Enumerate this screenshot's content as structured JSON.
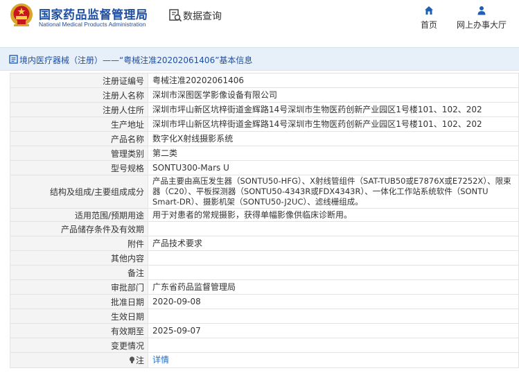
{
  "header": {
    "org_cn": "国家药品监督管理局",
    "org_en": "National Medical Products Administration",
    "query_label": "数据查询",
    "nav": [
      {
        "label": "首页",
        "icon": "home-icon"
      },
      {
        "label": "网上办事大厅",
        "icon": "user-icon"
      }
    ]
  },
  "title_bar": {
    "text": "境内医疗器械（注册）——“粤械注准20202061406”基本信息",
    "icon": "document-icon"
  },
  "detail": {
    "rows": [
      {
        "label": "注册证编号",
        "value": "粤械注准20202061406"
      },
      {
        "label": "注册人名称",
        "value": "深圳市深图医学影像设备有限公司"
      },
      {
        "label": "注册人住所",
        "value": "深圳市坪山新区坑梓街道金辉路14号深圳市生物医药创新产业园区1号楼101、102、202"
      },
      {
        "label": "生产地址",
        "value": "深圳市坪山新区坑梓街道金辉路14号深圳市生物医药创新产业园区1号楼101、102、202"
      },
      {
        "label": "产品名称",
        "value": "数字化X射线摄影系统"
      },
      {
        "label": "管理类别",
        "value": "第二类"
      },
      {
        "label": "型号规格",
        "value": "SONTU300-Mars U"
      },
      {
        "label": "结构及组成/主要组成成分",
        "value": "产品主要由高压发生器（SONTU50-HFG）、X射线管组件（SAT-TUB50或E7876X或E7252X）、限束器（C20）、平板探测器（SONTU50-4343R或FDX4343R）、一体化工作站系统软件（SONTU Smart-DR）、摄影机架（SONTU50-J2UC）、滤线栅组成。"
      },
      {
        "label": "适用范围/预期用途",
        "value": "用于对患者的常规摄影，获得单幅影像供临床诊断用。"
      },
      {
        "label": "产品储存条件及有效期",
        "value": ""
      },
      {
        "label": "附件",
        "value": "产品技术要求"
      },
      {
        "label": "其他内容",
        "value": ""
      },
      {
        "label": "备注",
        "value": ""
      },
      {
        "label": "审批部门",
        "value": "广东省药品监督管理局"
      },
      {
        "label": "批准日期",
        "value": "2020-09-08"
      },
      {
        "label": "生效日期",
        "value": ""
      },
      {
        "label": "有效期至",
        "value": "2025-09-07"
      },
      {
        "label": "变更情况",
        "value": ""
      }
    ],
    "note_row": {
      "label": "注",
      "icon": "lightbulb-icon",
      "link_text": "详情"
    }
  }
}
